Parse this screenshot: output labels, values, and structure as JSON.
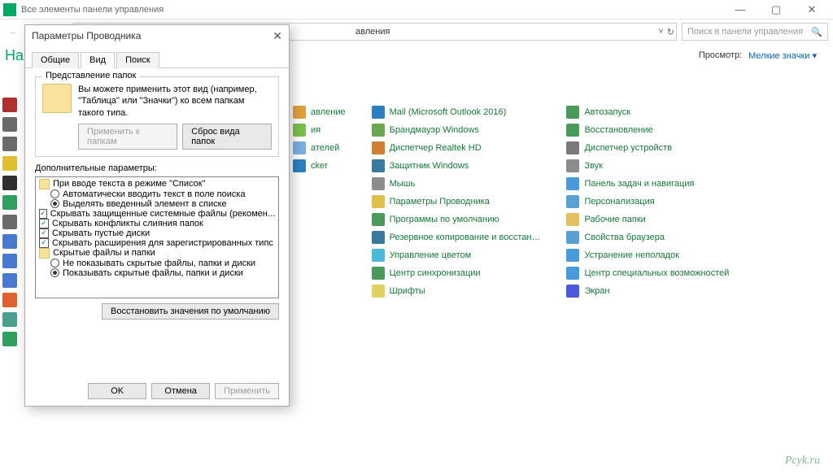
{
  "window": {
    "title": "Все элементы панели управления",
    "close": "✕",
    "max": "▢",
    "min": "—"
  },
  "addressbar": {
    "text": "авления",
    "dropdown": "˅",
    "refresh": "↻"
  },
  "search": {
    "placeholder": "Поиск в панели управления",
    "icon": "🔍"
  },
  "heading": "На",
  "viewrow": {
    "label": "Просмотр:",
    "value": "Мелкие значки ▾"
  },
  "cp_cols": [
    [
      {
        "label": "авление",
        "color": "#e1a03a"
      },
      {
        "label": "ия",
        "color": "#7abf4a"
      },
      {
        "label": "ателей",
        "color": "#7ab0e0"
      },
      {
        "label": "cker",
        "color": "#2c80c0"
      }
    ],
    [
      {
        "label": "Mail (Microsoft Outlook 2016)",
        "color": "#2c80c0"
      },
      {
        "label": "Брандмауэр Windows",
        "color": "#6aa84f"
      },
      {
        "label": "Диспетчер Realtek HD",
        "color": "#d08030"
      },
      {
        "label": "Защитник Windows",
        "color": "#3a7aa0"
      },
      {
        "label": "Мышь",
        "color": "#8c8c8c"
      },
      {
        "label": "Параметры Проводника",
        "color": "#e1c04a"
      },
      {
        "label": "Программы по умолчанию",
        "color": "#4a9a5a"
      },
      {
        "label": "Резервное копирование и восстан…",
        "color": "#3a7aa0"
      },
      {
        "label": "Управление цветом",
        "color": "#4abada"
      },
      {
        "label": "Центр синхронизации",
        "color": "#4a9a5a"
      },
      {
        "label": "Шрифты",
        "color": "#e0d060"
      }
    ],
    [
      {
        "label": "Автозапуск",
        "color": "#4a9a5a"
      },
      {
        "label": "Восстановление",
        "color": "#4a9a5a"
      },
      {
        "label": "Диспетчер устройств",
        "color": "#7a7a7a"
      },
      {
        "label": "Звук",
        "color": "#8c8c8c"
      },
      {
        "label": "Панель задач и навигация",
        "color": "#4a9ada"
      },
      {
        "label": "Персонализация",
        "color": "#5aa0d0"
      },
      {
        "label": "Рабочие папки",
        "color": "#e0c060"
      },
      {
        "label": "Свойства браузера",
        "color": "#5aa0d0"
      },
      {
        "label": "Устранение неполадок",
        "color": "#4a9ada"
      },
      {
        "label": "Центр специальных возможностей",
        "color": "#4a9ada"
      },
      {
        "label": "Экран",
        "color": "#4a5ada"
      }
    ]
  ],
  "dialog": {
    "title": "Параметры Проводника",
    "close": "✕",
    "tabs": [
      "Общие",
      "Вид",
      "Поиск"
    ],
    "active_tab": 1,
    "group_title": "Представление папок",
    "group_text": "Вы можете применить этот вид (например, \"Таблица\" или \"Значки\") ко всем папкам такого типа.",
    "btn_apply_folders": "Применить к папкам",
    "btn_reset_folders": "Сброс вида папок",
    "adv_label": "Дополнительные параметры:",
    "tree": [
      {
        "type": "folder",
        "label": "При вводе текста в режиме \"Список\"",
        "indent": 0
      },
      {
        "type": "radio",
        "selected": false,
        "label": "Автоматически вводить текст в поле поиска",
        "indent": 1
      },
      {
        "type": "radio",
        "selected": true,
        "label": "Выделять введенный элемент в списке",
        "indent": 1
      },
      {
        "type": "check",
        "checked": true,
        "label": "Скрывать защищенные системные файлы (рекомен...",
        "indent": 0
      },
      {
        "type": "check",
        "checked": true,
        "label": "Скрывать конфликты слияния папок",
        "indent": 0
      },
      {
        "type": "check",
        "checked": true,
        "label": "Скрывать пустые диски",
        "indent": 0
      },
      {
        "type": "check",
        "checked": true,
        "label": "Скрывать расширения для зарегистрированных типс",
        "indent": 0
      },
      {
        "type": "folder",
        "label": "Скрытые файлы и папки",
        "indent": 0
      },
      {
        "type": "radio",
        "selected": false,
        "label": "Не показывать скрытые файлы, папки и диски",
        "indent": 1
      },
      {
        "type": "radio",
        "selected": true,
        "label": "Показывать скрытые файлы, папки и диски",
        "indent": 1
      }
    ],
    "btn_restore": "Восстановить значения по умолчанию",
    "btn_ok": "OK",
    "btn_cancel": "Отмена",
    "btn_apply": "Применить"
  },
  "dock_colors": [
    "#b03030",
    "#6a6a6a",
    "#6a6a6a",
    "#e0c030",
    "#303030",
    "#30a060",
    "#6a6a6a",
    "#4a7ad0",
    "#4a7ad0",
    "#4a7ad0",
    "#e06030",
    "#4aa090",
    "#30a060"
  ],
  "watermark": "Pcyk.ru"
}
